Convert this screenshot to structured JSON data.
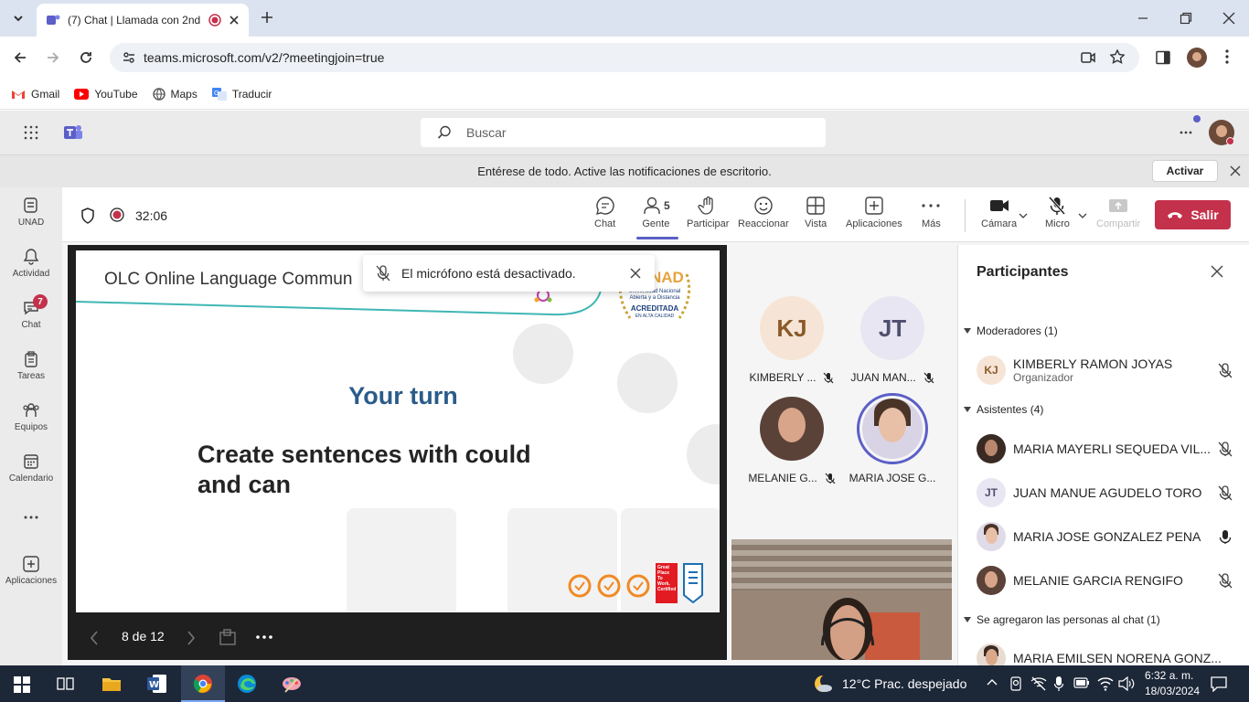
{
  "browser": {
    "tab_title": "(7) Chat | Llamada con 2nd",
    "url": "teams.microsoft.com/v2/?meetingjoin=true",
    "bookmarks": [
      "Gmail",
      "YouTube",
      "Maps",
      "Traducir"
    ]
  },
  "teams": {
    "search_placeholder": "Buscar",
    "notification": "Entérese de todo. Active las notificaciones de escritorio.",
    "notification_button": "Activar"
  },
  "rail": {
    "items": [
      {
        "label": "UNAD",
        "icon": "unad-icon"
      },
      {
        "label": "Actividad",
        "icon": "bell-icon"
      },
      {
        "label": "Chat",
        "icon": "chat-icon",
        "badge": "7"
      },
      {
        "label": "Tareas",
        "icon": "tasks-icon"
      },
      {
        "label": "Equipos",
        "icon": "teams-icon"
      },
      {
        "label": "Calendario",
        "icon": "calendar-icon"
      },
      {
        "label": "",
        "icon": "more-icon"
      },
      {
        "label": "Aplicaciones",
        "icon": "apps-icon"
      }
    ]
  },
  "meeting": {
    "timer": "32:06",
    "toolbar": {
      "chat": "Chat",
      "people": "Gente",
      "people_count": "5",
      "raise": "Participar",
      "react": "Reaccionar",
      "view": "Vista",
      "apps": "Aplicaciones",
      "more": "Más",
      "camera": "Cámara",
      "mic": "Micro",
      "share": "Compartir",
      "leave": "Salir"
    },
    "toast": "El micrófono está desactivado.",
    "slide": {
      "header": "OLC Online Language Commun",
      "title": "Your turn",
      "body": "Create sentences with could and can",
      "logo_line1": "Universidad Nacional",
      "logo_line2": "Abierta y a Distancia",
      "logo_line3": "ACREDITADA",
      "logo_line4": "EN ALTA CALIDAD",
      "logo_brand": "NAD",
      "badge_gptw": "Great Place To Work. Certified"
    },
    "slide_counter": "8 de 12",
    "gallery": [
      {
        "initials": "KJ",
        "name": "KIMBERLY ...",
        "color": "#f6e5d6",
        "text_color": "#8a5a2b"
      },
      {
        "initials": "JT",
        "name": "JUAN MAN...",
        "color": "#e8e6f2",
        "text_color": "#4f4f6e"
      },
      {
        "initials": "",
        "name": "MELANIE G...",
        "color": "#5a4238"
      },
      {
        "initials": "",
        "name": "MARIA JOSE G...",
        "color": "#d8d4e6"
      }
    ]
  },
  "participants": {
    "title": "Participantes",
    "moderators_label": "Moderadores (1)",
    "attendees_label": "Asistentes (4)",
    "added_label": "Se agregaron las personas al chat (1)",
    "moderators": [
      {
        "initials": "KJ",
        "name": "KIMBERLY RAMON JOYAS",
        "role": "Organizador"
      }
    ],
    "attendees": [
      {
        "initials": "",
        "name": "MARIA MAYERLI SEQUEDA VIL...",
        "mic": "muted"
      },
      {
        "initials": "JT",
        "name": "JUAN MANUE AGUDELO TORO",
        "mic": "muted"
      },
      {
        "initials": "",
        "name": "MARIA JOSE GONZALEZ PENA",
        "mic": "on"
      },
      {
        "initials": "",
        "name": "MELANIE GARCIA RENGIFO",
        "mic": "muted"
      }
    ],
    "added": [
      {
        "initials": "",
        "name": "MARIA EMILSEN NORENA GONZ..."
      }
    ]
  },
  "taskbar": {
    "weather": "12°C  Prac. despejado",
    "time": "6:32 a. m.",
    "date": "18/03/2024"
  },
  "colors": {
    "teams_purple": "#5b5fc7",
    "leave_red": "#c4314b",
    "slide_title": "#2a5c8a"
  }
}
